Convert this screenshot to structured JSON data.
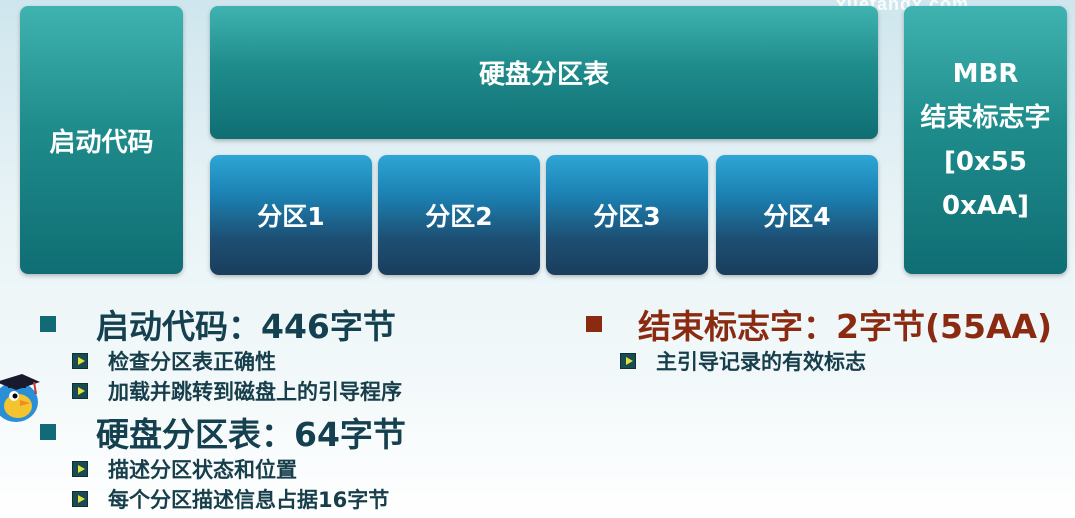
{
  "watermark": "xuetangx.com",
  "diagram": {
    "boot_code": "启动代码",
    "partition_table": "硬盘分区表",
    "partitions": [
      "分区1",
      "分区2",
      "分区3",
      "分区4"
    ],
    "mbr_end": "MBR\n结束标志字\n[0x55\n0xAA]"
  },
  "bullets": {
    "boot": {
      "title": "启动代码：446字节",
      "items": [
        "检查分区表正确性",
        "加载并跳转到磁盘上的引导程序"
      ]
    },
    "table": {
      "title": "硬盘分区表：64字节",
      "items": [
        "描述分区状态和位置",
        "每个分区描述信息占据16字节"
      ]
    },
    "end": {
      "title": "结束标志字：2字节(55AA)",
      "items": [
        "主引导记录的有效标志"
      ]
    }
  },
  "colors": {
    "teal_box": "#1f8c8c",
    "blue_box": "#1d4f73",
    "heading_dark": "#15404f",
    "heading_red": "#8a2a10"
  },
  "icons": [
    "play-bullet-icon",
    "square-bullet-icon",
    "mascot-icon",
    "logo-icon"
  ]
}
